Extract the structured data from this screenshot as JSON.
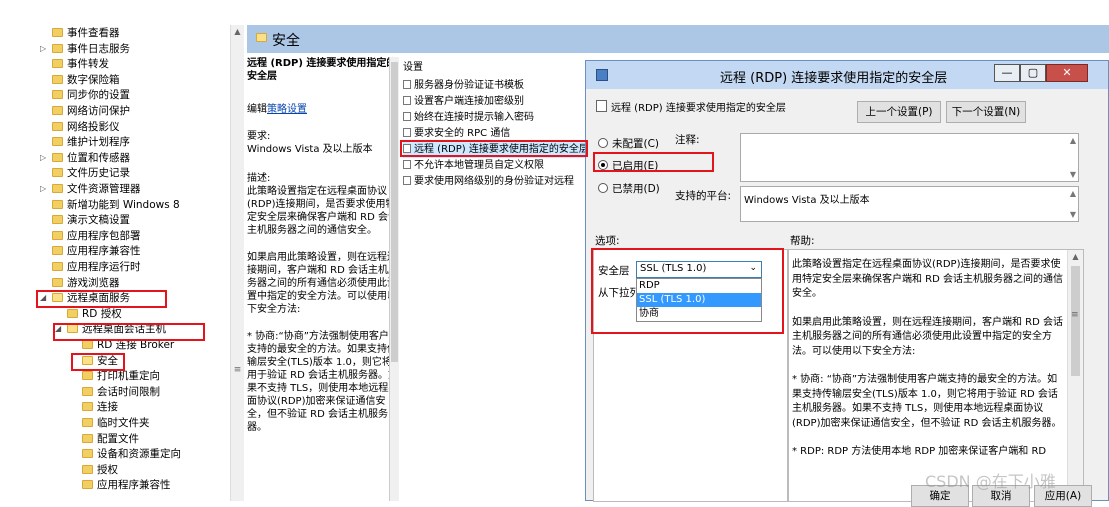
{
  "tree": {
    "items": [
      {
        "label": "事件查看器",
        "expand": false
      },
      {
        "label": "事件日志服务",
        "expand": true
      },
      {
        "label": "事件转发",
        "expand": false
      },
      {
        "label": "数字保险箱",
        "expand": false
      },
      {
        "label": "同步你的设置",
        "expand": false
      },
      {
        "label": "网络访问保护",
        "expand": false
      },
      {
        "label": "网络投影仪",
        "expand": false
      },
      {
        "label": "维护计划程序",
        "expand": false
      },
      {
        "label": "位置和传感器",
        "expand": true
      },
      {
        "label": "文件历史记录",
        "expand": false
      },
      {
        "label": "文件资源管理器",
        "expand": true
      },
      {
        "label": "新增功能到 Windows 8",
        "expand": false
      },
      {
        "label": "演示文稿设置",
        "expand": false
      },
      {
        "label": "应用程序包部署",
        "expand": false
      },
      {
        "label": "应用程序兼容性",
        "expand": false
      },
      {
        "label": "应用程序运行时",
        "expand": false
      },
      {
        "label": "游戏浏览器",
        "expand": false
      },
      {
        "label": "远程桌面服务",
        "expand": true,
        "open": true
      },
      {
        "label": "RD 授权",
        "expand": false
      },
      {
        "label": "远程桌面会话主机",
        "expand": true,
        "open": true
      },
      {
        "label": "RD 连接 Broker",
        "expand": false
      },
      {
        "label": "安全",
        "expand": false,
        "open": true
      },
      {
        "label": "打印机重定向",
        "expand": false
      },
      {
        "label": "会话时间限制",
        "expand": false
      },
      {
        "label": "连接",
        "expand": false
      },
      {
        "label": "临时文件夹",
        "expand": false
      },
      {
        "label": "配置文件",
        "expand": false
      },
      {
        "label": "设备和资源重定向",
        "expand": false
      },
      {
        "label": "授权",
        "expand": false
      },
      {
        "label": "应用程序兼容性",
        "expand": false
      }
    ]
  },
  "header": {
    "title": "安全"
  },
  "description": {
    "policy_title": "远程 (RDP) 连接要求使用指定的安全层",
    "edit_prefix": "编辑",
    "edit_link": "策略设置",
    "requirements_label": "要求:",
    "requirements_value": "Windows Vista 及以上版本",
    "desc_label": "描述:",
    "desc_text": "此策略设置指定在远程桌面协议(RDP)连接期间，是否要求使用特定安全层来确保客户端和 RD 会话主机服务器之间的通信安全。",
    "desc_text2": "如果启用此策略设置，则在远程连接期间，客户端和 RD 会话主机服务器之间的所有通信必须使用此设置中指定的安全方法。可以使用以下安全方法:",
    "desc_text3": "* 协商:“协商”方法强制使用客户端支持的最安全的方法。如果支持传输层安全(TLS)版本 1.0，则它将用于验证 RD 会话主机服务器。如果不支持 TLS，则使用本地远程桌面协议(RDP)加密来保证通信安全，但不验证 RD 会话主机服务器。"
  },
  "settings": {
    "column_header": "设置",
    "items": [
      "服务器身份验证证书模板",
      "设置客户端连接加密级别",
      "始终在连接时提示输入密码",
      "要求安全的 RPC 通信",
      "远程 (RDP) 连接要求使用指定的安全层",
      "不允许本地管理员自定义权限",
      "要求使用网络级别的身份验证对远程"
    ]
  },
  "dialog": {
    "title": "远程 (RDP) 连接要求使用指定的安全层",
    "policy_name": "远程 (RDP) 连接要求使用指定的安全层",
    "prev_button": "上一个设置(P)",
    "next_button": "下一个设置(N)",
    "radio_not_configured": "未配置(C)",
    "radio_enabled": "已启用(E)",
    "radio_disabled": "已禁用(D)",
    "comment_label": "注释:",
    "supported_label": "支持的平台:",
    "supported_value": "Windows Vista 及以上版本",
    "options_label": "选项:",
    "help_label": "帮助:",
    "security_layer_label": "安全层",
    "security_layer_value": "SSL (TLS 1.0)",
    "dropdown_hint": "从下拉列",
    "dropdown_options": [
      "RDP",
      "SSL (TLS 1.0)",
      "协商"
    ],
    "help_p1": "此策略设置指定在远程桌面协议(RDP)连接期间，是否要求使用特定安全层来确保客户端和 RD 会话主机服务器之间的通信安全。",
    "help_p2": "如果启用此策略设置，则在远程连接期间，客户端和 RD 会话主机服务器之间的所有通信必须使用此设置中指定的安全方法。可以使用以下安全方法:",
    "help_p3": "* 协商: “协商”方法强制使用客户端支持的最安全的方法。如果支持传输层安全(TLS)版本 1.0，则它将用于验证 RD 会话主机服务器。如果不支持 TLS，则使用本地远程桌面协议(RDP)加密来保证通信安全，但不验证 RD 会话主机服务器。",
    "help_p4": "* RDP: RDP 方法使用本地 RDP 加密来保证客户端和 RD",
    "ok_button": "确定",
    "cancel_button": "取消",
    "apply_button": "应用(A)"
  },
  "watermark": "CSDN @在下小雅"
}
